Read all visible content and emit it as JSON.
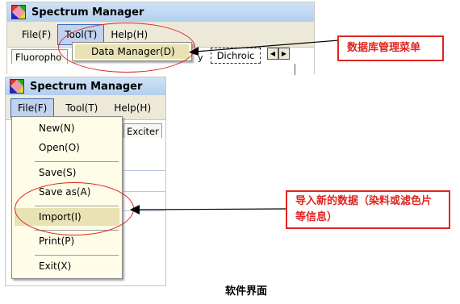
{
  "window_top": {
    "title": "Spectrum Manager",
    "menu": {
      "file": "File(F)",
      "tool": "Tool(T)",
      "help": "Help(H)"
    },
    "tool_dropdown": {
      "data_manager": "Data Manager(D)"
    },
    "tabs": {
      "fluorophore": "Fluoropho",
      "dichroic": "Dichroic"
    }
  },
  "window_bottom": {
    "title": "Spectrum Manager",
    "menu": {
      "file": "File(F)",
      "tool": "Tool(T)",
      "help": "Help(H)"
    },
    "file_dropdown": {
      "new": "New(N)",
      "open": "Open(O)",
      "save": "Save(S)",
      "save_as": "Save as(A)",
      "import": "Import(I)",
      "print": "Print(P)",
      "exit": "Exit(X)"
    },
    "tabs": {
      "exciter": "Exciter"
    }
  },
  "annotations": {
    "data_manager_note": "数据库管理菜单",
    "import_note": "导入新的数据（染料或滤色片等信息）"
  },
  "caption": "软件界面",
  "colors": {
    "annotation_red": "#e0241f",
    "menu_bg": "#ece9d8",
    "dropdown_bg": "#fffde8",
    "title_bg": "#b3cfee"
  }
}
